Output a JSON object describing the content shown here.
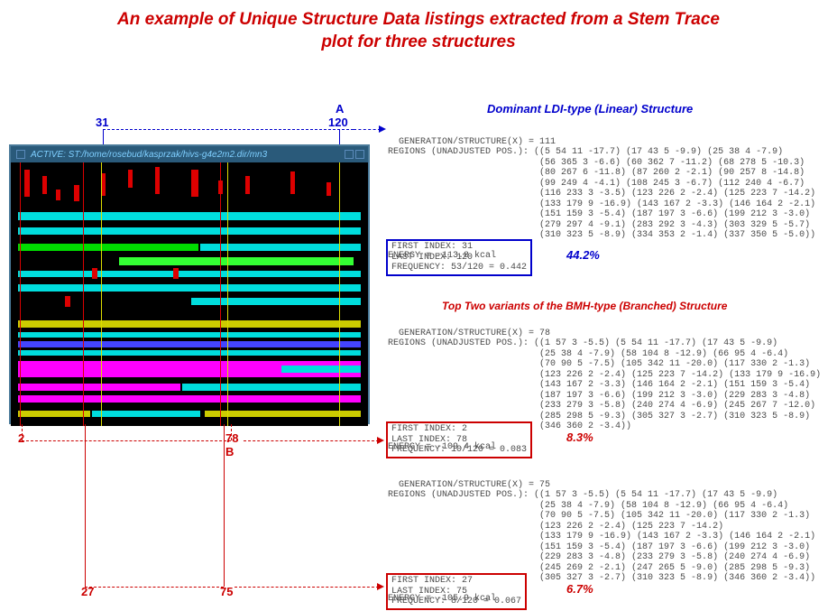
{
  "title_line1": "An example of Unique Structure Data listings extracted from a Stem Trace",
  "title_line2": "plot for three structures",
  "section1_title": "Dominant LDI-type (Linear) Structure",
  "section2_title": "Top Two variants of the BMH-type (Branched) Structure",
  "window_title": "ACTIVE:  ST:/home/rosebud/kasprzak/hivs-g4e2m2.dir/mn3",
  "labels": {
    "A": "A",
    "B": "B",
    "31": "31",
    "120": "120",
    "2": "2",
    "78": "78",
    "27": "27",
    "75": "75"
  },
  "percentages": {
    "p1": "44.2%",
    "p2": "8.3%",
    "p3": "6.7%"
  },
  "listing1": {
    "header": "GENERATION/STRUCTURE(X) = 111",
    "regions_label": "REGIONS (UNADJUSTED POS.): ",
    "regions": "((5 54 11 -17.7) (17 43 5 -9.9) (25 38 4 -7.9)\n (56 365 3 -6.6) (60 362 7 -11.2) (68 278 5 -10.3)\n (80 267 6 -11.8) (87 260 2 -2.1) (90 257 8 -14.8)\n (99 249 4 -4.1) (108 245 3 -6.7) (112 240 4 -6.7)\n (116 233 3 -3.5) (123 226 2 -2.4) (125 223 7 -14.2)\n (133 179 9 -16.9) (143 167 2 -3.3) (146 164 2 -2.1)\n (151 159 3 -5.4) (187 197 3 -6.6) (199 212 3 -3.0)\n (279 297 4 -9.1) (283 292 3 -4.3) (303 329 5 -5.7)\n (310 323 5 -8.9) (334 353 2 -1.4) (337 350 5 -5.0))",
    "energy": "ENERGY = -113.8 kcal",
    "first_index": "FIRST INDEX: 31",
    "last_index": "LAST INDEX: 120",
    "frequency": "FREQUENCY: 53/120 = 0.442"
  },
  "listing2": {
    "header": "GENERATION/STRUCTURE(X) = 78",
    "regions_label": "REGIONS (UNADJUSTED POS.): ",
    "regions": "((1 57 3 -5.5) (5 54 11 -17.7) (17 43 5 -9.9)\n (25 38 4 -7.9) (58 104 8 -12.9) (66 95 4 -6.4)\n (70 90 5 -7.5) (105 342 11 -20.0) (117 330 2 -1.3)\n (123 226 2 -2.4) (125 223 7 -14.2) (133 179 9 -16.9)\n (143 167 2 -3.3) (146 164 2 -2.1) (151 159 3 -5.4)\n (187 197 3 -6.6) (199 212 3 -3.0) (229 283 3 -4.8)\n (233 279 3 -5.8) (240 274 4 -6.9) (245 267 7 -12.0)\n (285 298 5 -9.3) (305 327 3 -2.7) (310 323 5 -8.9)\n (346 360 2 -3.4))",
    "energy": "ENERGY = -109.4 kcal",
    "first_index": "FIRST INDEX: 2",
    "last_index": "LAST INDEX: 78",
    "frequency": "FREQUENCY: 10/120 = 0.083"
  },
  "listing3": {
    "header": "GENERATION/STRUCTURE(X) = 75",
    "regions_label": "REGIONS (UNADJUSTED POS.): ",
    "regions": "((1 57 3 -5.5) (5 54 11 -17.7) (17 43 5 -9.9)\n (25 38 4 -7.9) (58 104 8 -12.9) (66 95 4 -6.4)\n (70 90 5 -7.5) (105 342 11 -20.0) (117 330 2 -1.3)\n (123 226 2 -2.4) (125 223 7 -14.2)\n (133 179 9 -16.9) (143 167 2 -3.3) (146 164 2 -2.1)\n (151 159 3 -5.4) (187 197 3 -6.6) (199 212 3 -3.0)\n (229 283 3 -4.8) (233 279 3 -5.8) (240 274 4 -6.9)\n (245 269 2 -2.1) (247 265 5 -9.0) (285 298 5 -9.3)\n (305 327 3 -2.7) (310 323 5 -8.9) (346 360 2 -3.4))",
    "energy": "ENERGY = -105.9 kcal",
    "first_index": "FIRST INDEX: 27",
    "last_index": "LAST INDEX: 75",
    "frequency": "FREQUENCY: 8/120 = 0.067"
  }
}
